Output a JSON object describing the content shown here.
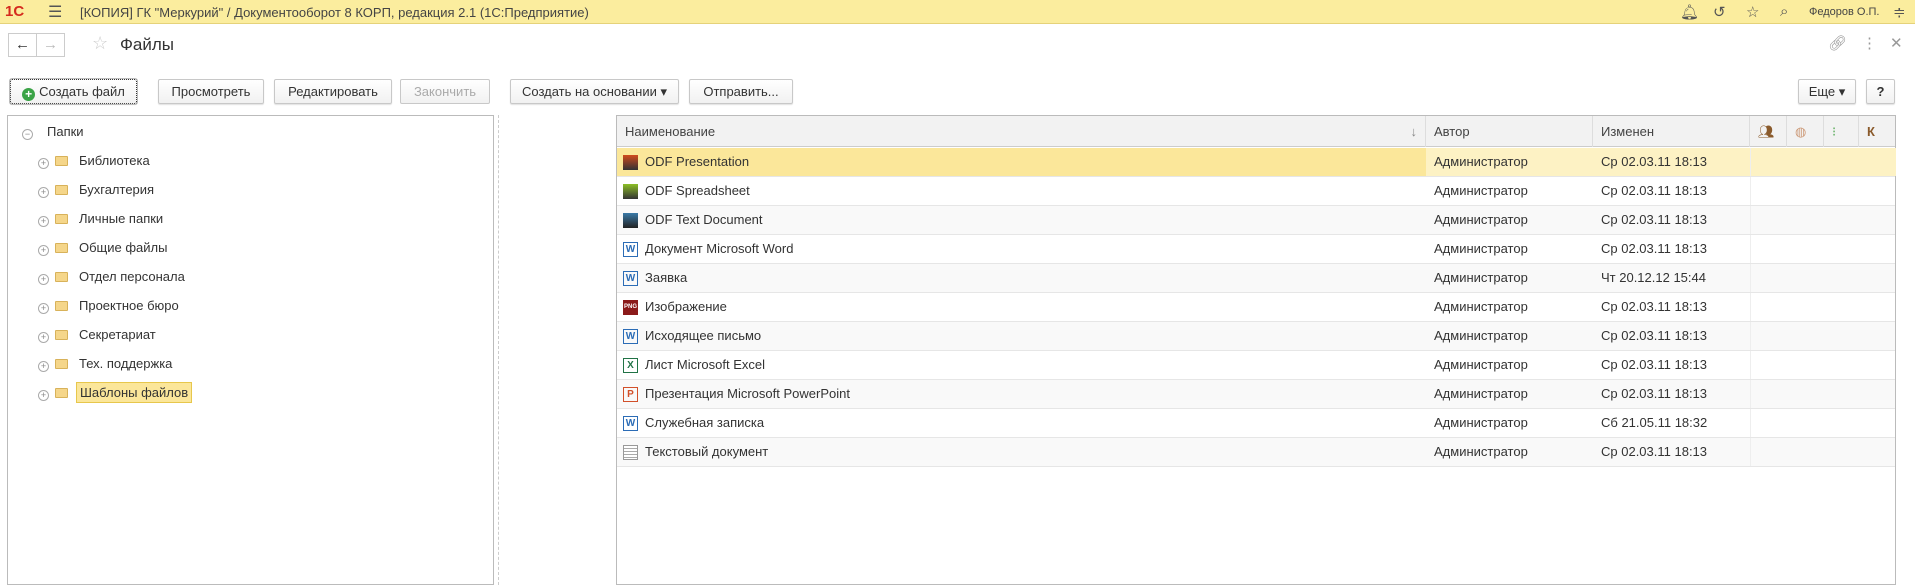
{
  "app": {
    "logo": "1С",
    "title": "[КОПИЯ] ГК \"Меркурий\" / Документооборот 8 КОРП, редакция 2.1  (1С:Предприятие)",
    "user": "Федоров О.П."
  },
  "page": {
    "title": "Файлы"
  },
  "toolbar": {
    "create": "Создать файл",
    "view": "Просмотреть",
    "edit": "Редактировать",
    "finish": "Закончить",
    "create_based": "Создать на основании ▾",
    "send": "Отправить...",
    "more": "Еще ▾",
    "help": "?"
  },
  "tree": {
    "root": "Папки",
    "items": [
      "Библиотека",
      "Бухгалтерия",
      "Личные папки",
      "Общие файлы",
      "Отдел персонала",
      "Проектное бюро",
      "Секретариат",
      "Тех. поддержка",
      "Шаблоны файлов"
    ]
  },
  "table": {
    "columns": {
      "name": "Наименование",
      "author": "Автор",
      "changed": "Изменен",
      "k": "К"
    },
    "sort_indicator": "↓",
    "rows": [
      {
        "icon": "odp",
        "name": "ODF Presentation",
        "author": "Администратор",
        "changed": "Ср 02.03.11 18:13"
      },
      {
        "icon": "ods",
        "name": "ODF Spreadsheet",
        "author": "Администратор",
        "changed": "Ср 02.03.11 18:13"
      },
      {
        "icon": "odt",
        "name": "ODF Text Document",
        "author": "Администратор",
        "changed": "Ср 02.03.11 18:13"
      },
      {
        "icon": "w",
        "name": "Документ Microsoft Word",
        "author": "Администратор",
        "changed": "Ср 02.03.11 18:13"
      },
      {
        "icon": "w",
        "name": "Заявка",
        "author": "Администратор",
        "changed": "Чт 20.12.12 15:44"
      },
      {
        "icon": "png",
        "name": "Изображение",
        "author": "Администратор",
        "changed": "Ср 02.03.11 18:13"
      },
      {
        "icon": "w",
        "name": "Исходящее письмо",
        "author": "Администратор",
        "changed": "Ср 02.03.11 18:13"
      },
      {
        "icon": "x",
        "name": "Лист Microsoft Excel",
        "author": "Администратор",
        "changed": "Ср 02.03.11 18:13"
      },
      {
        "icon": "p",
        "name": "Презентация Microsoft PowerPoint",
        "author": "Администратор",
        "changed": "Ср 02.03.11 18:13"
      },
      {
        "icon": "w",
        "name": "Служебная записка",
        "author": "Администратор",
        "changed": "Сб 21.05.11 18:32"
      },
      {
        "icon": "txt",
        "name": "Текстовый документ",
        "author": "Администратор",
        "changed": "Ср 02.03.11 18:13"
      }
    ]
  }
}
